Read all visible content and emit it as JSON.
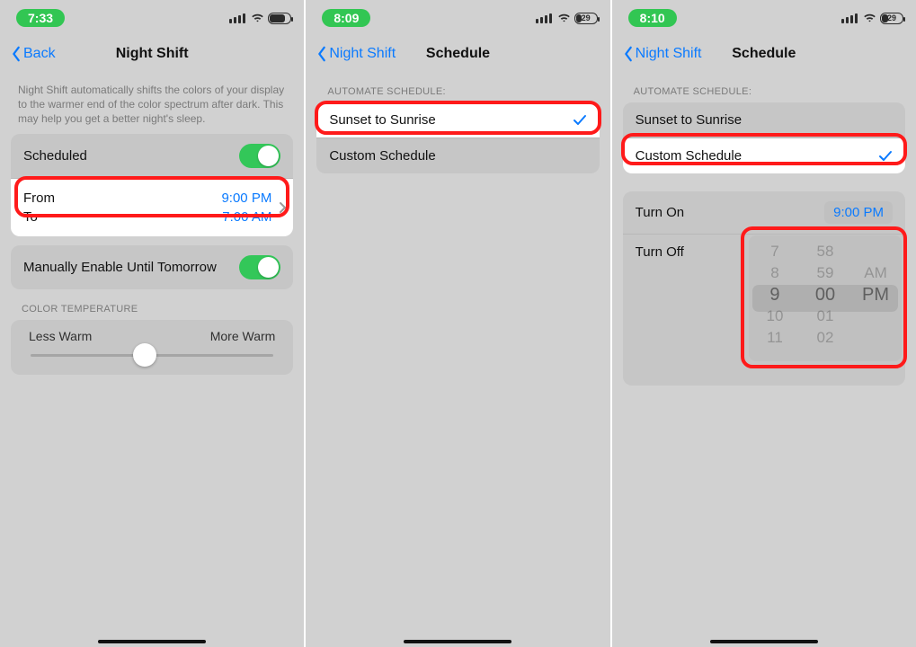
{
  "screen1": {
    "status": {
      "time": "7:33",
      "battery": "81"
    },
    "nav": {
      "back": "Back",
      "title": "Night Shift"
    },
    "desc": "Night Shift automatically shifts the colors of your display to the warmer end of the color spectrum after dark. This may help you get a better night's sleep.",
    "scheduled_label": "Scheduled",
    "scheduled_on": true,
    "from_label": "From",
    "from_time": "9:00 PM",
    "to_label": "To",
    "to_time": "7:00 AM",
    "manual_label": "Manually Enable Until Tomorrow",
    "manual_on": true,
    "temp_header": "COLOR TEMPERATURE",
    "less_warm": "Less Warm",
    "more_warm": "More Warm"
  },
  "screen2": {
    "status": {
      "time": "8:09",
      "battery": "29"
    },
    "nav": {
      "back": "Night Shift",
      "title": "Schedule"
    },
    "header": "AUTOMATE SCHEDULE:",
    "opt1": "Sunset to Sunrise",
    "opt1_selected": true,
    "opt2": "Custom Schedule",
    "opt2_selected": false
  },
  "screen3": {
    "status": {
      "time": "8:10",
      "battery": "29"
    },
    "nav": {
      "back": "Night Shift",
      "title": "Schedule"
    },
    "header": "AUTOMATE SCHEDULE:",
    "opt1": "Sunset to Sunrise",
    "opt2": "Custom Schedule",
    "opt2_selected": true,
    "turn_on_label": "Turn On",
    "turn_on_time": "9:00 PM",
    "turn_off_label": "Turn Off",
    "picker": {
      "hours": [
        "7",
        "8",
        "9",
        "10",
        "11"
      ],
      "mins": [
        "58",
        "59",
        "00",
        "01",
        "02"
      ],
      "ampm": [
        "",
        "AM",
        "PM",
        "",
        ""
      ],
      "sel_h": "9",
      "sel_m": "00",
      "sel_ap": "PM"
    }
  }
}
